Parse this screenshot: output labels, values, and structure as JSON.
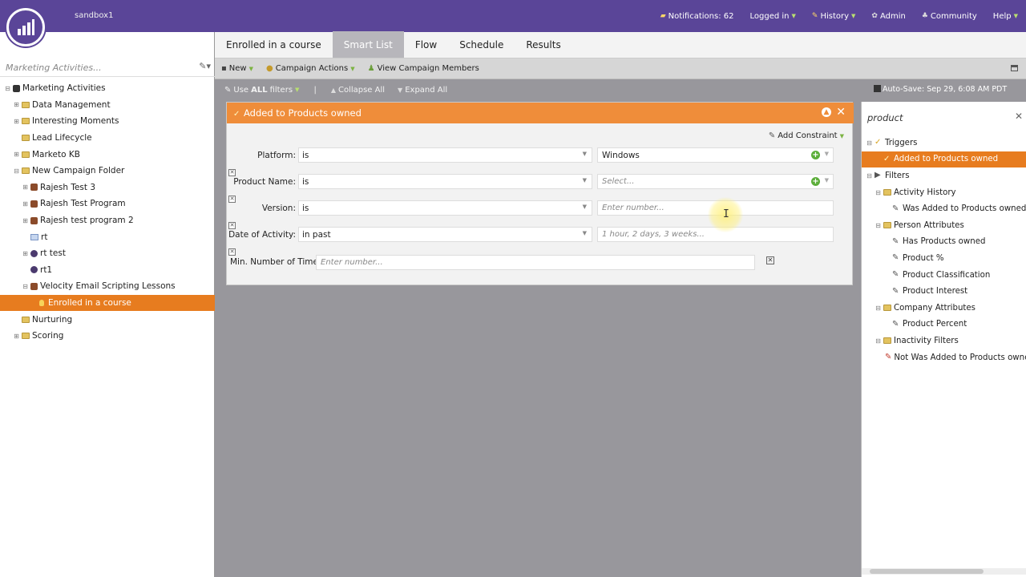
{
  "header": {
    "workspace": "sandbox1",
    "nav": [
      {
        "label": "Notifications: 62",
        "icon": "notification-icon"
      },
      {
        "label": "Logged in",
        "caret": true
      },
      {
        "label": "History",
        "caret": true,
        "icon": "history-icon"
      },
      {
        "label": "Admin",
        "icon": "gear-icon"
      },
      {
        "label": "Community",
        "icon": "community-icon"
      },
      {
        "label": "Help",
        "caret": true
      }
    ]
  },
  "left_panel": {
    "search_placeholder": "Marketing Activities...",
    "tree": [
      {
        "label": "Marketing Activities",
        "level": 0,
        "toggle": "⊟",
        "icon": "root"
      },
      {
        "label": "Data Management",
        "level": 1,
        "toggle": "⊞",
        "icon": "folder"
      },
      {
        "label": "Interesting Moments",
        "level": 1,
        "toggle": "⊞",
        "icon": "folder"
      },
      {
        "label": "Lead Lifecycle",
        "level": 1,
        "toggle": "",
        "icon": "folder"
      },
      {
        "label": "Marketo KB",
        "level": 1,
        "toggle": "⊞",
        "icon": "folder"
      },
      {
        "label": "New Campaign Folder",
        "level": 1,
        "toggle": "⊟",
        "icon": "folder"
      },
      {
        "label": "Rajesh Test 3",
        "level": 2,
        "toggle": "⊞",
        "icon": "program"
      },
      {
        "label": "Rajesh Test Program",
        "level": 2,
        "toggle": "⊞",
        "icon": "program"
      },
      {
        "label": "Rajesh test program 2",
        "level": 2,
        "toggle": "⊞",
        "icon": "program"
      },
      {
        "label": "rt",
        "level": 2,
        "toggle": "",
        "icon": "calendar"
      },
      {
        "label": "rt test",
        "level": 2,
        "toggle": "⊞",
        "icon": "program-round"
      },
      {
        "label": "rt1",
        "level": 2,
        "toggle": "",
        "icon": "program-round"
      },
      {
        "label": "Velocity Email Scripting Lessons",
        "level": 2,
        "toggle": "⊟",
        "icon": "program"
      },
      {
        "label": "Enrolled in a course",
        "level": 3,
        "toggle": "",
        "icon": "campaign",
        "selected": true
      },
      {
        "label": "Nurturing",
        "level": 1,
        "toggle": "",
        "icon": "folder"
      },
      {
        "label": "Scoring",
        "level": 1,
        "toggle": "⊞",
        "icon": "folder"
      }
    ]
  },
  "tabs": [
    {
      "label": "Enrolled in a course",
      "active": false
    },
    {
      "label": "Smart List",
      "active": true
    },
    {
      "label": "Flow",
      "active": false
    },
    {
      "label": "Schedule",
      "active": false
    },
    {
      "label": "Results",
      "active": false
    }
  ],
  "toolbar": {
    "new_label": "New",
    "campaign_actions_label": "Campaign Actions",
    "view_members_label": "View Campaign Members"
  },
  "filter_toolbar": {
    "use_prefix": "Use ",
    "use_all": "ALL",
    "use_suffix": " filters",
    "separator": "|",
    "collapse_all": "Collapse All",
    "expand_all": "Expand All",
    "autosave": "Auto-Save: Sep 29, 6:08 AM PDT"
  },
  "filter_card": {
    "title": "Added to Products owned",
    "add_constraint": "Add Constraint",
    "constraints": [
      {
        "label": "Platform:",
        "operator": "is",
        "value": "Windows",
        "placeholder": false,
        "plus": true
      },
      {
        "label": "Product Name:",
        "operator": "is",
        "value": "Select...",
        "placeholder": true,
        "plus": true
      },
      {
        "label": "Version:",
        "operator": "is",
        "value": "Enter number...",
        "placeholder": true,
        "plus": false
      },
      {
        "label": "Date of Activity:",
        "operator": "in past",
        "value": "1 hour, 2 days, 3 weeks...",
        "placeholder": true,
        "plus": false
      }
    ],
    "min_times_label": "Min. Number of Times:",
    "min_times_placeholder": "Enter number..."
  },
  "right_panel": {
    "search_value": "product",
    "tree": [
      {
        "label": "Triggers",
        "level": 0,
        "toggle": "⊟",
        "icon": "trigger-group"
      },
      {
        "label": "Added to Products owned",
        "level": 1,
        "toggle": "",
        "icon": "trigger",
        "selected": true
      },
      {
        "label": "Filters",
        "level": 0,
        "toggle": "⊟",
        "icon": "filter-group"
      },
      {
        "label": "Activity History",
        "level": 1,
        "toggle": "⊟",
        "icon": "folder"
      },
      {
        "label": "Was Added to Products owned",
        "level": 2,
        "toggle": "",
        "icon": "filter"
      },
      {
        "label": "Person Attributes",
        "level": 1,
        "toggle": "⊟",
        "icon": "folder"
      },
      {
        "label": "Has Products owned",
        "level": 2,
        "toggle": "",
        "icon": "filter"
      },
      {
        "label": "Product %",
        "level": 2,
        "toggle": "",
        "icon": "filter"
      },
      {
        "label": "Product Classification",
        "level": 2,
        "toggle": "",
        "icon": "filter"
      },
      {
        "label": "Product Interest",
        "level": 2,
        "toggle": "",
        "icon": "filter"
      },
      {
        "label": "Company Attributes",
        "level": 1,
        "toggle": "⊟",
        "icon": "folder"
      },
      {
        "label": "Product Percent",
        "level": 2,
        "toggle": "",
        "icon": "filter"
      },
      {
        "label": "Inactivity Filters",
        "level": 1,
        "toggle": "⊟",
        "icon": "folder"
      },
      {
        "label": "Not Was Added to Products owned",
        "level": 2,
        "toggle": "",
        "icon": "not-filter"
      }
    ]
  },
  "colors": {
    "brand_purple": "#5a4598",
    "accent_orange": "#e77c1f",
    "card_header_orange": "#ef8d3a",
    "add_green": "#5cae3a"
  }
}
